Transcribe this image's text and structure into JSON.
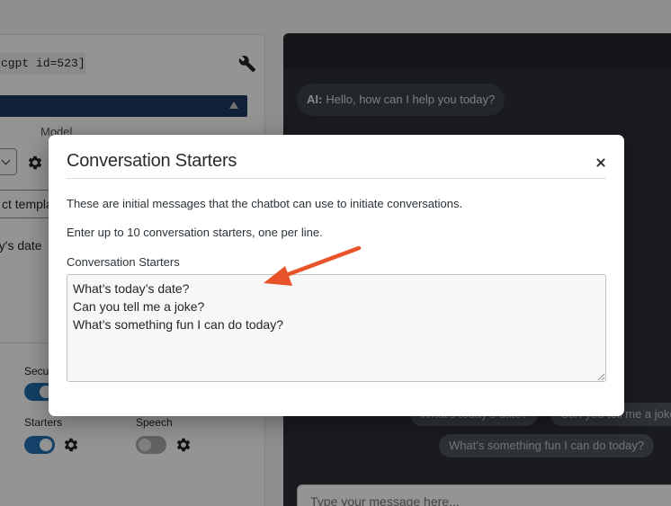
{
  "left_panel": {
    "shortcode": "cgpt id=523]",
    "model_label": "Model",
    "template_value": "ct templa",
    "starter_preview": "ay's date",
    "toggles": [
      {
        "label": "Secu",
        "state": "on"
      },
      {
        "label": "Starters",
        "state": "on"
      },
      {
        "label": "Speech",
        "state": "off"
      }
    ]
  },
  "chat": {
    "ai_prefix": "AI:",
    "ai_message": "Hello, how can I help you today?",
    "chips": [
      "What's today's date?",
      "Can you tell me a joke?",
      "What's something fun I can do today?"
    ],
    "input_placeholder": "Type your message here..."
  },
  "modal": {
    "title": "Conversation Starters",
    "description": "These are initial messages that the chatbot can use to initiate conversations.",
    "instruction": "Enter up to 10 conversation starters, one per line.",
    "field_label": "Conversation Starters",
    "starters_text": "What’s today’s date?\nCan you tell me a joke?\nWhat’s something fun I can do today?"
  },
  "colors": {
    "annotation_arrow": "#e8532a",
    "toggle_on": "#2271b1",
    "model_bar": "#1e3a5f",
    "chat_bg": "#2b2f36"
  }
}
